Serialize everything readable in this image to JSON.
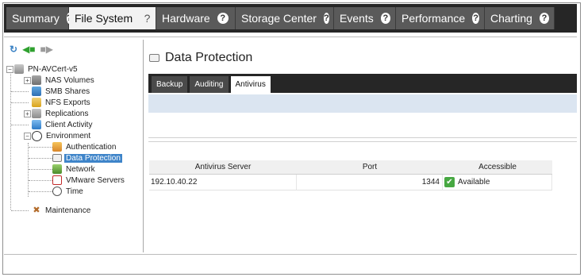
{
  "top_tabs": [
    {
      "label": "Summary",
      "active": false
    },
    {
      "label": "File System",
      "active": true
    },
    {
      "label": "Hardware",
      "active": false
    },
    {
      "label": "Storage Center",
      "active": false
    },
    {
      "label": "Events",
      "active": false
    },
    {
      "label": "Performance",
      "active": false
    },
    {
      "label": "Charting",
      "active": false
    }
  ],
  "help_glyph": "?",
  "toolbar": {
    "refresh": "refresh-icon",
    "back": "back-arrow-icon",
    "forward": "forward-arrow-icon"
  },
  "tree": {
    "root": "PN-AVCert-v5",
    "nas_volumes": "NAS Volumes",
    "smb_shares": "SMB Shares",
    "nfs_exports": "NFS Exports",
    "replications": "Replications",
    "client_activity": "Client Activity",
    "environment": "Environment",
    "authentication": "Authentication",
    "data_protection": "Data Protection",
    "network": "Network",
    "vmware_servers": "VMware Servers",
    "time": "Time",
    "maintenance": "Maintenance"
  },
  "content": {
    "title": "Data Protection",
    "sub_tabs": [
      "Backup",
      "Auditing",
      "Antivirus"
    ],
    "active_sub_tab": "Antivirus",
    "grid": {
      "headers": [
        "Antivirus Server",
        "Port",
        "Accessible"
      ],
      "rows": [
        {
          "server": "192.10.40.22",
          "port": "1344",
          "accessible": "Available"
        }
      ]
    }
  },
  "colors": {
    "selection": "#3e84c9",
    "band": "#dbe5f1",
    "available": "#47a842"
  }
}
